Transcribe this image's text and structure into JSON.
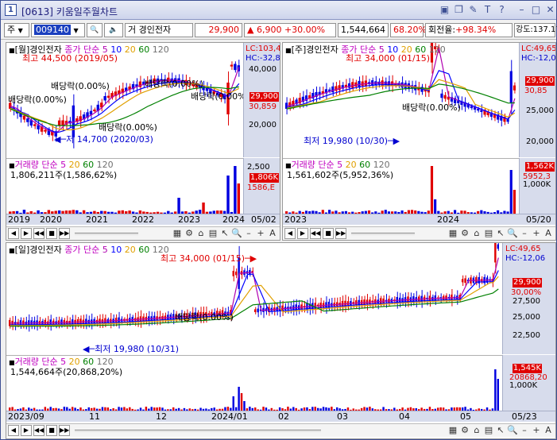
{
  "window": {
    "number": "1",
    "title": "[0613] 키움일주월차트",
    "buttons": [
      "▣",
      "❐",
      "✎",
      "T",
      "?",
      "–",
      "□",
      "✕"
    ]
  },
  "toolbar": {
    "market": "주",
    "code": "009140",
    "code_suffix": "거",
    "name": "경인전자",
    "price": "29,900",
    "change": "6,900",
    "change_pct": "+30.00%",
    "volume": "1,544,664",
    "volume_ratio": "68.20%",
    "turnover_label": "회전율:",
    "turnover": "+98.34%",
    "strength_label": "강도:",
    "strength": "137.17%",
    "colors": {
      "up": "#ff0000",
      "down": "#0000ff"
    }
  },
  "monthly": {
    "title": "[월]경인전자",
    "ma_label": "종가 단순",
    "ma_periods": [
      "5",
      "10",
      "20",
      "60",
      "120"
    ],
    "lc": "LC:103,4",
    "hc": "HC:-32,8",
    "high_note": "최고 44,500 (2019/05)",
    "low_note": "저 14,700 (2020/03)",
    "dividends": [
      "배당락(0.00%)",
      "배당락(0.00%)",
      "배당락(0.00%)",
      "배당락(0.00%)",
      "배당락(0.00%)"
    ],
    "ticks": [
      "40,000",
      "30,859",
      "20,000"
    ],
    "price_tag": "29,900",
    "vol_title": "거래량 단순",
    "vol_periods": [
      "5",
      "20",
      "60",
      "120"
    ],
    "vol_text": "1,806,211주(1,586,62%)",
    "vol_ticks": [
      "2,500",
      "1,806K",
      "1586,E"
    ],
    "dates": [
      "2019",
      "2020",
      "2021",
      "2022",
      "2023",
      "2024",
      "05/02"
    ]
  },
  "weekly": {
    "title": "[주]경인전자",
    "ma_label": "종가 단순",
    "ma_periods": [
      "5",
      "10",
      "20",
      "60",
      "120"
    ],
    "lc": "LC:49,65",
    "hc": "HC:-12,0",
    "high_note": "최고 34,000 (01/15)",
    "low_note": "최저 19,980 (10/30)",
    "dividends": [
      "배당락(0.00%)"
    ],
    "ticks": [
      "29,900",
      "30,85",
      "25,000",
      "20,000"
    ],
    "vol_title": "거래량 단순",
    "vol_periods": [
      "5",
      "20",
      "60",
      "120"
    ],
    "vol_text": "1,561,602주(5,952,36%)",
    "vol_ticks": [
      "1,562K",
      "5952,3",
      "1,000K"
    ],
    "dates": [
      "2023",
      "2024",
      "05/20"
    ]
  },
  "daily": {
    "title": "[일]경인전자",
    "ma_label": "종가 단순",
    "ma_periods": [
      "5",
      "10",
      "20",
      "60",
      "120"
    ],
    "lc": "LC:49,65",
    "hc": "HC:-12,06",
    "high_note": "최고 34,000 (01/15)",
    "low_note": "최저 19,980 (10/31)",
    "dividends": [
      "배당락(0.00%)"
    ],
    "ticks": [
      "29,900",
      "30,00%",
      "27,500",
      "25,000",
      "22,500"
    ],
    "vol_title": "거래량 단순",
    "vol_periods": [
      "5",
      "20",
      "60",
      "120"
    ],
    "vol_text": "1,544,664주(20,868,20%)",
    "vol_ticks": [
      "1,545K",
      "20868,20",
      "1,000K"
    ],
    "dates": [
      "2023/09",
      "11",
      "12",
      "2024/01",
      "02",
      "03",
      "04",
      "05",
      "05/23"
    ]
  },
  "nav": {
    "buttons": [
      "◀",
      "▶",
      "◀◀",
      "■",
      "▶▶"
    ],
    "tools": [
      "▦",
      "⚙",
      "⌂",
      "▤",
      "↖",
      "🔍",
      "–",
      "+",
      "A"
    ]
  }
}
